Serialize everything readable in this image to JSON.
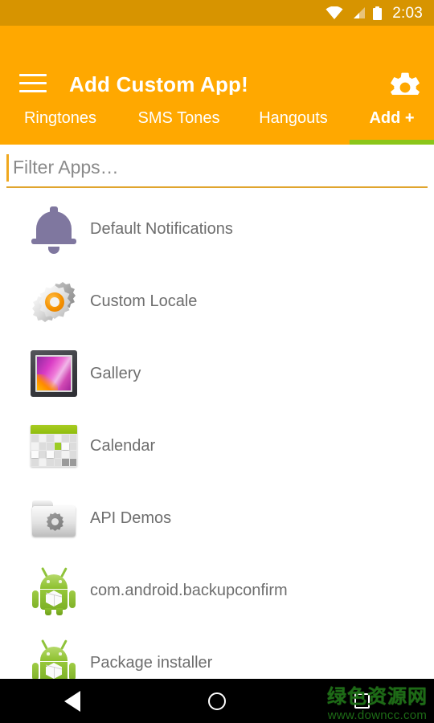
{
  "colors": {
    "status_bar": "#d79400",
    "app_bar": "#ffa800",
    "tab_indicator": "#8bc61a",
    "field_underline": "#e0a52e",
    "list_text": "#6e6e6e",
    "nav_bar": "#000000",
    "watermark": "#1d6b16"
  },
  "status_bar": {
    "time": "2:03",
    "icons": [
      "wifi-icon",
      "cellular-signal-icon",
      "battery-icon"
    ]
  },
  "app_bar": {
    "menu_icon": "hamburger-menu-icon",
    "title": "Add Custom App!",
    "settings_icon": "gear-icon"
  },
  "tabs": [
    {
      "label": "Ringtones",
      "active": false
    },
    {
      "label": "SMS Tones",
      "active": false
    },
    {
      "label": "Hangouts",
      "active": false
    },
    {
      "label": "Add +",
      "active": true
    }
  ],
  "filter": {
    "value": "",
    "placeholder": "Filter Apps…"
  },
  "app_list": [
    {
      "label": "Default Notifications",
      "icon": "bell-icon"
    },
    {
      "label": "Custom Locale",
      "icon": "gears-icon"
    },
    {
      "label": "Gallery",
      "icon": "gallery-picture-icon"
    },
    {
      "label": "Calendar",
      "icon": "calendar-icon"
    },
    {
      "label": "API Demos",
      "icon": "folder-gear-icon"
    },
    {
      "label": "com.android.backupconfirm",
      "icon": "android-robot-icon"
    },
    {
      "label": "Package installer",
      "icon": "android-robot-icon"
    }
  ],
  "nav_bar": {
    "back_label": "back-icon",
    "home_label": "home-icon",
    "recents_label": "recents-icon"
  },
  "watermark": {
    "site_name": "绿色资源网",
    "url": "www.downcc.com"
  }
}
